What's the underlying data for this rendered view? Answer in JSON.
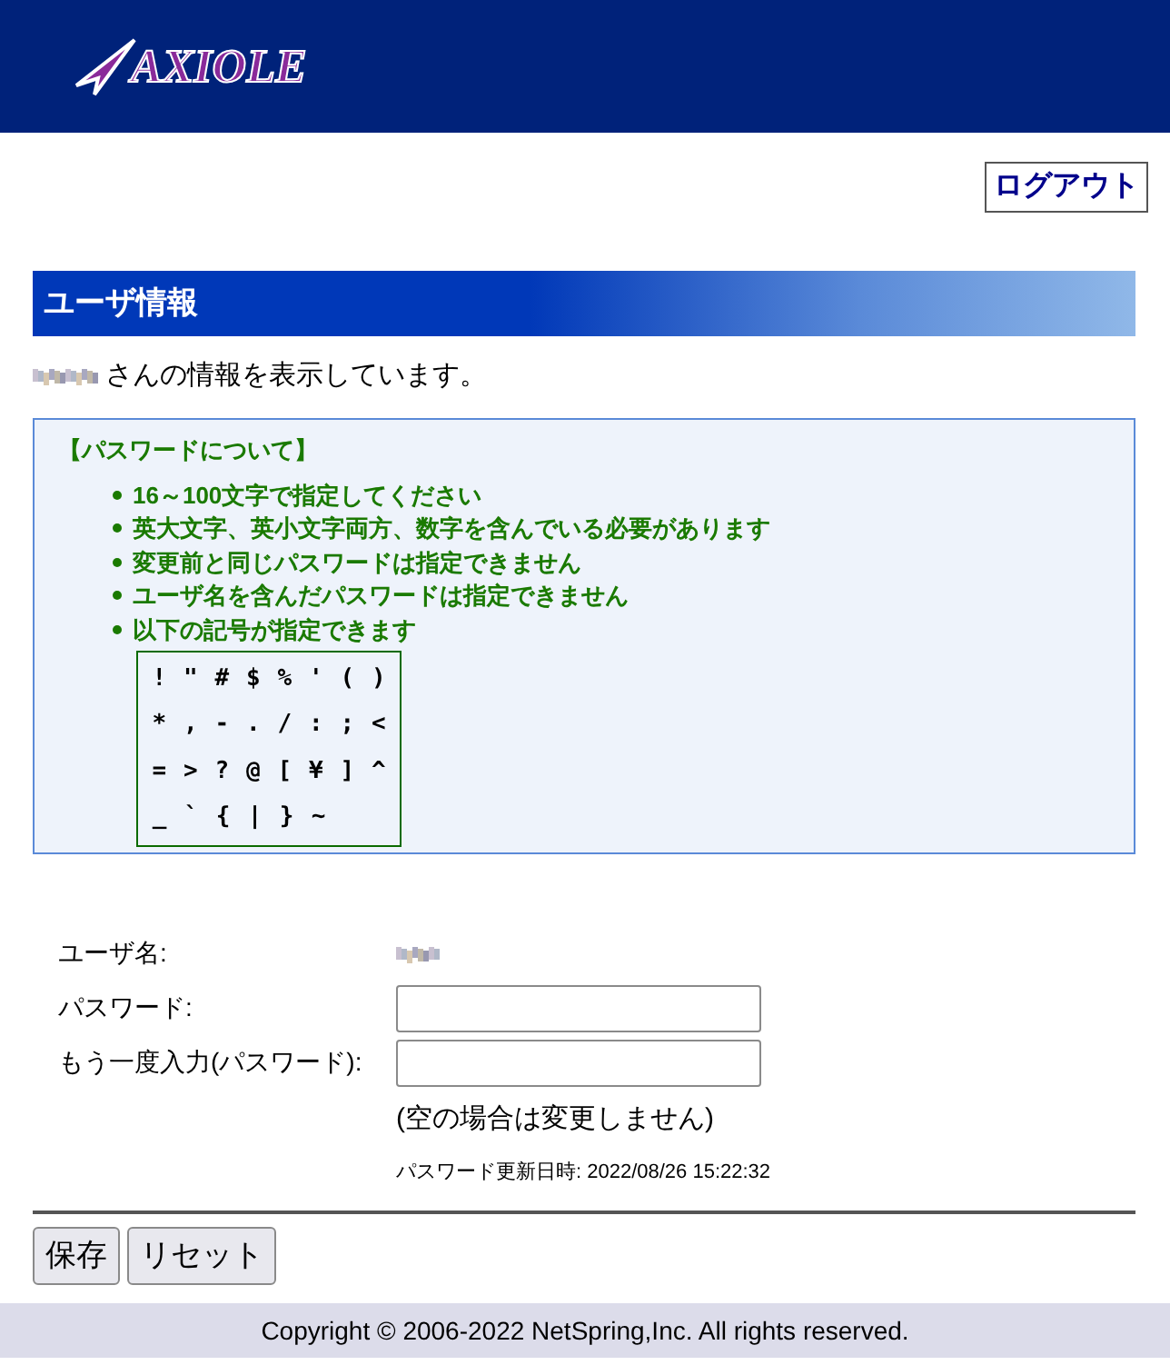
{
  "header": {
    "logo": "AXIOLE"
  },
  "logout_button": "ログアウト",
  "section_title": "ユーザ情報",
  "intro": {
    "text": "さんの情報を表示しています。"
  },
  "password_rules": {
    "title": "【パスワードについて】",
    "rules": [
      "16～100文字で指定してください",
      "英大文字、英小文字両方、数字を含んでいる必要があります",
      "変更前と同じパスワードは指定できません",
      "ユーザ名を含んだパスワードは指定できません",
      "以下の記号が指定できます"
    ],
    "symbols": [
      [
        "!",
        "\"",
        "#",
        "$",
        "%",
        "'",
        "(",
        ")"
      ],
      [
        "*",
        ",",
        "-",
        ".",
        "/",
        ":",
        ";",
        "<"
      ],
      [
        "=",
        ">",
        "?",
        "@",
        "[",
        "¥",
        "]",
        "^"
      ],
      [
        "_",
        "`",
        "{",
        "|",
        "}",
        "~"
      ]
    ]
  },
  "form": {
    "fields": [
      {
        "kind": "static",
        "label": "ユーザ名:"
      },
      {
        "kind": "input",
        "label": "パスワード:"
      },
      {
        "kind": "input",
        "label": "もう一度入力(パスワード):"
      }
    ],
    "note": "(空の場合は変更しません)",
    "updated": "パスワード更新日時: 2022/08/26 15:22:32"
  },
  "buttons": [
    "保存",
    "リセット"
  ],
  "footer": "Copyright © 2006-2022 NetSpring,Inc. All rights reserved."
}
